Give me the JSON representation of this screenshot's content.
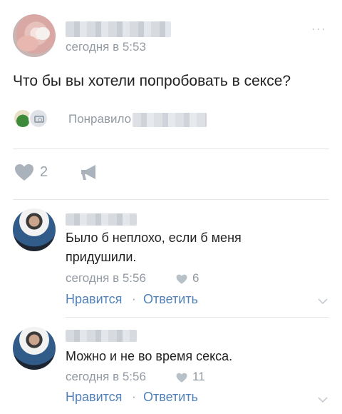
{
  "post": {
    "time": "сегодня в 5:53",
    "more": "···",
    "text": "Что бы вы хотели попробовать в сексе?",
    "liked_by": "Понравило",
    "likes_count": "2"
  },
  "comments": [
    {
      "text_line1": "Было б неплохо, если б меня",
      "text_line2": "придушили.",
      "time": "сегодня в 5:56",
      "likes": "6",
      "like_label": "Нравится",
      "separator": "·",
      "reply_label": "Ответить"
    },
    {
      "text_line1": "Можно и не во время секса.",
      "time": "сегодня в 5:56",
      "likes": "11",
      "like_label": "Нравится",
      "separator": "·",
      "reply_label": "Ответить"
    }
  ],
  "icons": {
    "heart": "heart-icon",
    "share": "megaphone-icon",
    "chevron": "chevron-down-icon",
    "camera": "camera-icon"
  },
  "colors": {
    "link": "#5181b8",
    "meta": "#929aa3",
    "divider": "#e4e6e9"
  }
}
